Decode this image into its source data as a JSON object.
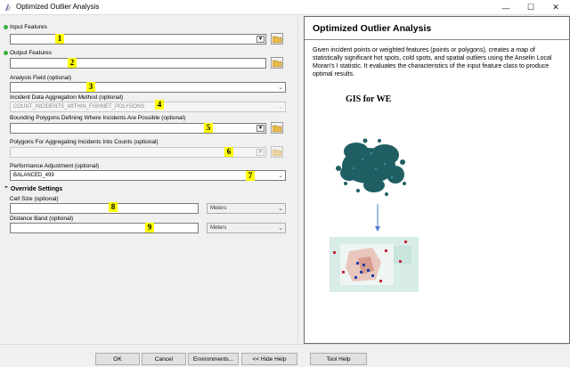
{
  "window": {
    "title": "Optimized Outlier Analysis",
    "min": "—",
    "max": "☐",
    "close": "✕"
  },
  "form": {
    "input_features": {
      "label": "Input Features",
      "marker": "1"
    },
    "output_features": {
      "label": "Output Features",
      "marker": "2"
    },
    "analysis_field": {
      "label": "Analysis Field (optional)",
      "marker": "3"
    },
    "aggregation_method": {
      "label": "Incident Data Aggregation Method (optional)",
      "value": "COUNT_INCIDENTS_WITHIN_FISHNET_POLYGONS",
      "marker": "4"
    },
    "bounding_polygons": {
      "label": "Bounding Polygons Defining Where Incidents Are Possible (optional)",
      "marker": "5"
    },
    "aggregating_polygons": {
      "label": "Polygons For Aggregating Incidents Into Counts (optional)",
      "marker": "6"
    },
    "performance": {
      "label": "Performance Adjustment (optional)",
      "value": "BALANCED_499",
      "marker": "7"
    },
    "override_header": "Override Settings",
    "cell_size": {
      "label": "Cell Size (optional)",
      "units": "Meters",
      "marker": "8"
    },
    "distance_band": {
      "label": "Distance Band (optional)",
      "units": "Meters",
      "marker": "9"
    }
  },
  "help": {
    "title": "Optimized Outlier Analysis",
    "body": "Given incident points or weighted features (points or polygons), creates a map of statistically significant hot spots, cold spots, and spatial outliers using the Anselin Local Moran's I statistic. It evaluates the characteristics of the input feature class to produce optimal results.",
    "watermark": "GIS for WE"
  },
  "buttons": {
    "ok": "OK",
    "cancel": "Cancel",
    "environments": "Environments...",
    "hide_help": "<< Hide Help",
    "tool_help": "Tool Help"
  }
}
